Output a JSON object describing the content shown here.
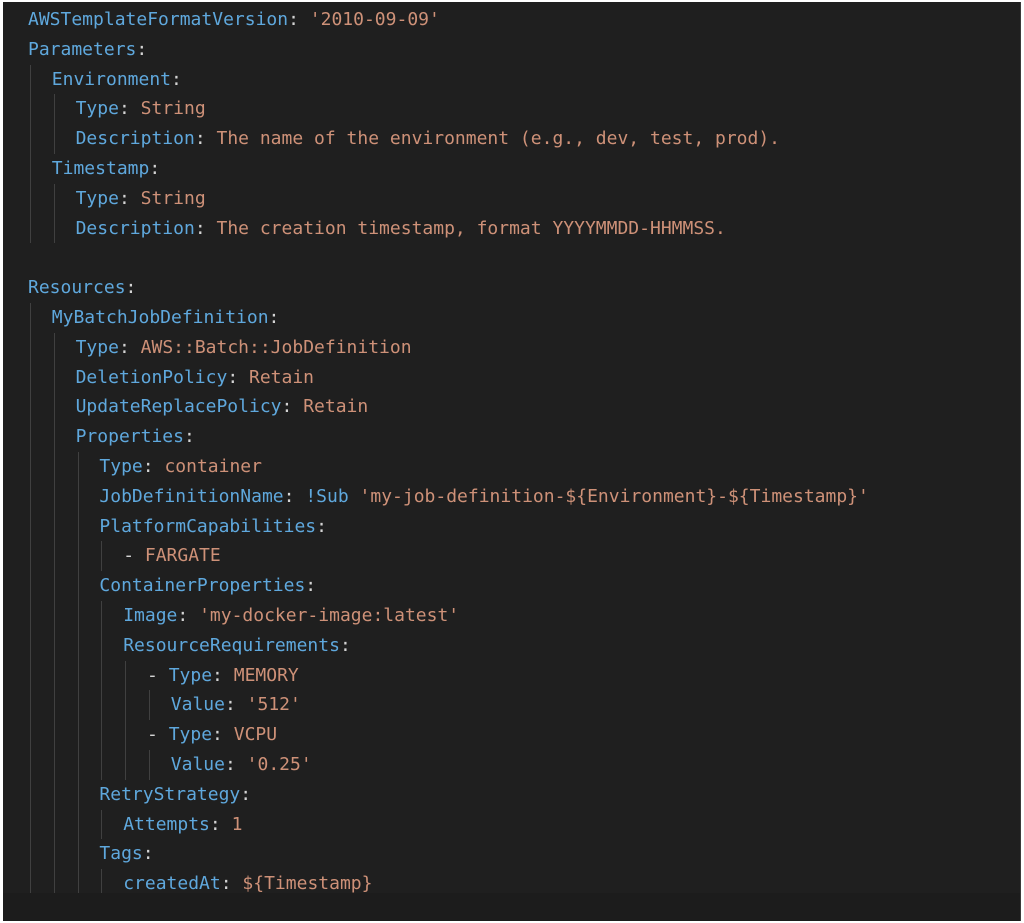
{
  "editor": {
    "lines": [
      {
        "indent": 0,
        "dash": "",
        "key": "AWSTemplateFormatVersion",
        "value": "'2010-09-09'"
      },
      {
        "indent": 0,
        "dash": "",
        "key": "Parameters",
        "value": ""
      },
      {
        "indent": 1,
        "dash": "",
        "key": "Environment",
        "value": ""
      },
      {
        "indent": 2,
        "dash": "",
        "key": "Type",
        "value": "String"
      },
      {
        "indent": 2,
        "dash": "",
        "key": "Description",
        "value": "The name of the environment (e.g., dev, test, prod)."
      },
      {
        "indent": 1,
        "dash": "",
        "key": "Timestamp",
        "value": ""
      },
      {
        "indent": 2,
        "dash": "",
        "key": "Type",
        "value": "String"
      },
      {
        "indent": 2,
        "dash": "",
        "key": "Description",
        "value": "The creation timestamp, format YYYYMMDD-HHMMSS."
      },
      {
        "indent": 0,
        "dash": "",
        "key": "",
        "value": ""
      },
      {
        "indent": 0,
        "dash": "",
        "key": "Resources",
        "value": ""
      },
      {
        "indent": 1,
        "dash": "",
        "key": "MyBatchJobDefinition",
        "value": ""
      },
      {
        "indent": 2,
        "dash": "",
        "key": "Type",
        "value": "AWS::Batch::JobDefinition"
      },
      {
        "indent": 2,
        "dash": "",
        "key": "DeletionPolicy",
        "value": "Retain"
      },
      {
        "indent": 2,
        "dash": "",
        "key": "UpdateReplacePolicy",
        "value": "Retain"
      },
      {
        "indent": 2,
        "dash": "",
        "key": "Properties",
        "value": ""
      },
      {
        "indent": 3,
        "dash": "",
        "key": "Type",
        "value": "container"
      },
      {
        "indent": 3,
        "dash": "",
        "key": "JobDefinitionName",
        "tag": "!Sub",
        "value": "'my-job-definition-${Environment}-${Timestamp}'"
      },
      {
        "indent": 3,
        "dash": "",
        "key": "PlatformCapabilities",
        "value": ""
      },
      {
        "indent": 4,
        "dash": "- ",
        "key": "",
        "value": "FARGATE"
      },
      {
        "indent": 3,
        "dash": "",
        "key": "ContainerProperties",
        "value": ""
      },
      {
        "indent": 4,
        "dash": "",
        "key": "Image",
        "value": "'my-docker-image:latest'"
      },
      {
        "indent": 4,
        "dash": "",
        "key": "ResourceRequirements",
        "value": ""
      },
      {
        "indent": 5,
        "dash": "- ",
        "key": "Type",
        "value": "MEMORY"
      },
      {
        "indent": 6,
        "dash": "",
        "key": "Value",
        "value": "'512'"
      },
      {
        "indent": 5,
        "dash": "- ",
        "key": "Type",
        "value": "VCPU"
      },
      {
        "indent": 6,
        "dash": "",
        "key": "Value",
        "value": "'0.25'"
      },
      {
        "indent": 3,
        "dash": "",
        "key": "RetryStrategy",
        "value": ""
      },
      {
        "indent": 4,
        "dash": "",
        "key": "Attempts",
        "value": "1"
      },
      {
        "indent": 3,
        "dash": "",
        "key": "Tags",
        "value": ""
      },
      {
        "indent": 4,
        "dash": "",
        "key": "createdAt",
        "value": "${Timestamp}"
      }
    ]
  },
  "colors": {
    "background": "#1f1f1f",
    "key": "#5fa8dd",
    "string": "#ce9178",
    "punctuation": "#d4d4d4",
    "indent_guide": "#404040"
  }
}
